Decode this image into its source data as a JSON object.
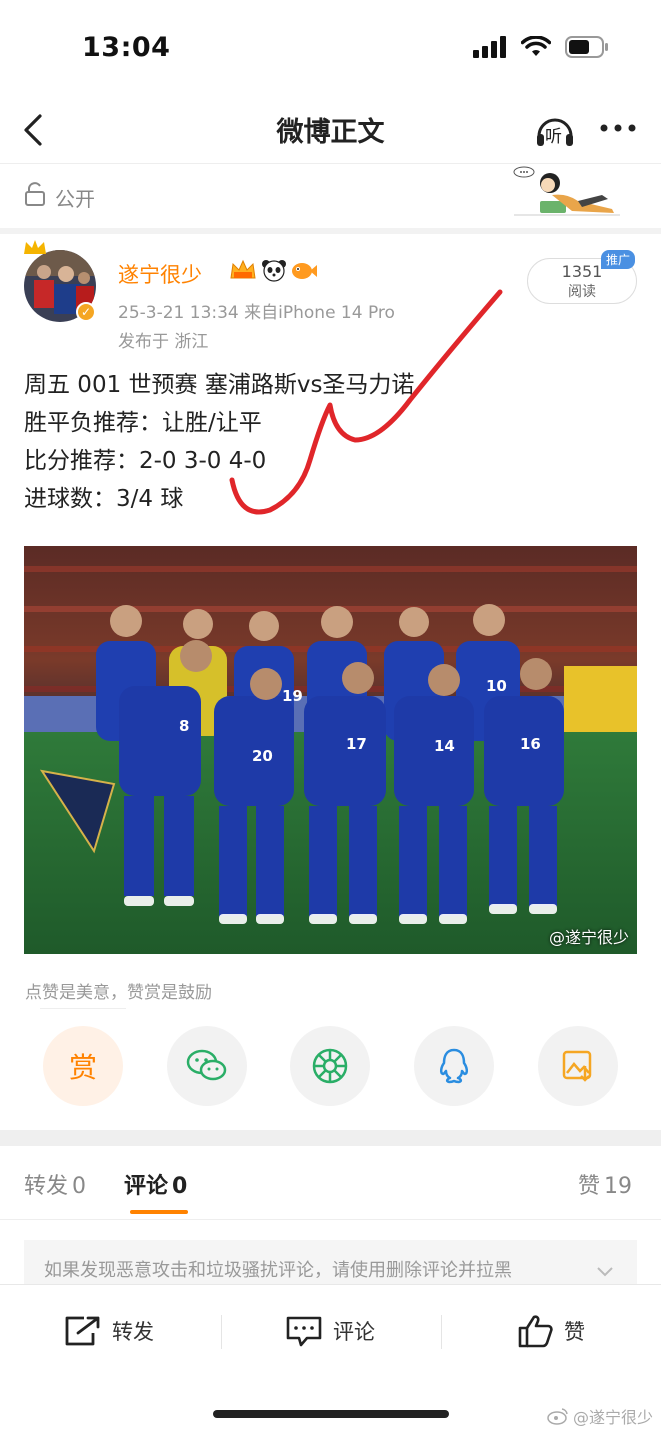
{
  "status_bar": {
    "time": "13:04"
  },
  "nav": {
    "title": "微博正文",
    "listen_label": "听"
  },
  "visibility": {
    "label": "公开"
  },
  "post": {
    "username": "遂宁很少",
    "meta": "25-3-21 13:34  来自iPhone 14 Pro",
    "location": "发布于 浙江",
    "read_count": "1351",
    "read_label": "阅读",
    "promo_tag": "推广",
    "lines": [
      "周五 001 世预赛 塞浦路斯vs圣马力诺",
      "胜平负推荐：让胜/让平",
      "比分推荐：2-0 3-0 4-0",
      "进球数：3/4 球"
    ],
    "photo_watermark": "@遂宁很少",
    "photo_jersey_numbers": [
      "8",
      "19",
      "10",
      "20",
      "17",
      "14",
      "16"
    ]
  },
  "reward_hint": "点赞是美意，赞赏是鼓励",
  "share": {
    "reward_label": "赏",
    "icons": [
      "reward-icon",
      "wechat-icon",
      "moments-icon",
      "qq-icon",
      "save-image-icon"
    ]
  },
  "tabs": [
    {
      "label": "转发",
      "count": "0"
    },
    {
      "label": "评论",
      "count": "0"
    },
    {
      "label": "赞",
      "count": "19"
    }
  ],
  "notice": "如果发现恶意攻击和垃圾骚扰评论，请使用删除评论并拉黑",
  "actions": {
    "repost": "转发",
    "comment": "评论",
    "like": "赞"
  },
  "corner_watermark": "@遂宁很少",
  "colors": {
    "accent": "#ff8200",
    "promo": "#4a90e2",
    "checkmark": "#e0262a"
  }
}
